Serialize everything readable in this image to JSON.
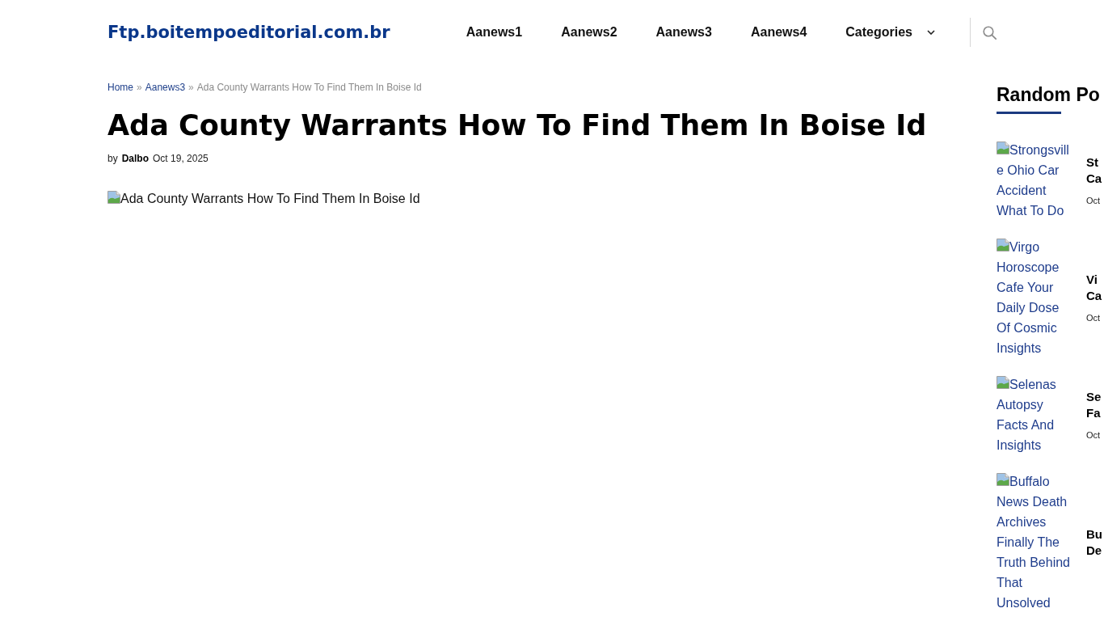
{
  "header": {
    "logo": "Ftp.boitempoeditorial.com.br",
    "nav": [
      {
        "label": "Aanews1",
        "kind": "link"
      },
      {
        "label": "Aanews2",
        "kind": "link"
      },
      {
        "label": "Aanews3",
        "kind": "link"
      },
      {
        "label": "Aanews4",
        "kind": "link"
      },
      {
        "label": "Categories",
        "kind": "dropdown"
      }
    ]
  },
  "breadcrumb": [
    {
      "text": "Home",
      "kind": "link"
    },
    {
      "text": "»",
      "kind": "separator"
    },
    {
      "text": "Aanews3",
      "kind": "link"
    },
    {
      "text": "»",
      "kind": "separator"
    },
    {
      "text": "Ada County Warrants How To Find Them In Boise Id",
      "kind": "current"
    }
  ],
  "article": {
    "title": "Ada County Warrants How To Find Them In Boise Id",
    "byline": {
      "prefix": "by",
      "author": "Dalbo",
      "date": "Oct 19, 2025"
    },
    "image_alt": "Ada County Warrants How To Find Them In Boise Id"
  },
  "sidebar": {
    "heading": "Random Po",
    "posts": [
      {
        "image_alt": "Strongsville Ohio Car Accident What To Do",
        "title": "St Ca",
        "date": "Oct"
      },
      {
        "image_alt": "Virgo Horoscope Cafe Your Daily Dose Of Cosmic Insights",
        "title": "Vi Ca",
        "date": "Oct"
      },
      {
        "image_alt": "Selenas Autopsy Facts And Insights",
        "title": "Se Fa",
        "date": "Oct"
      },
      {
        "image_alt": "Buffalo News Death Archives Finally The Truth Behind That Unsolved",
        "title": "Bu De"
      }
    ]
  }
}
